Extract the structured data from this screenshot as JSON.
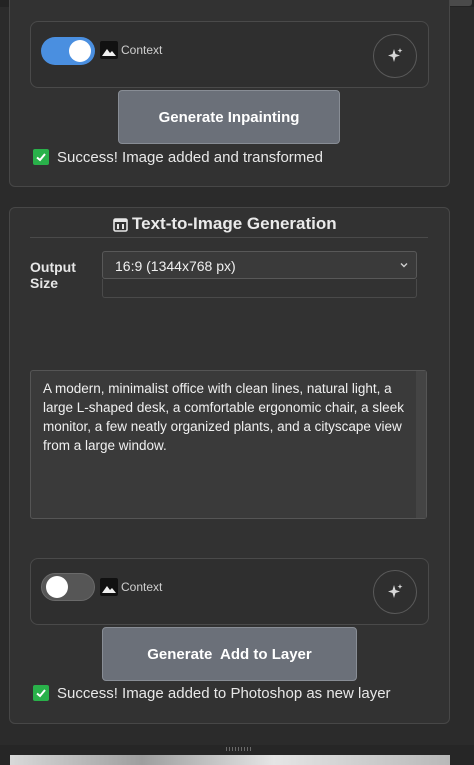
{
  "inpainting_panel": {
    "context_toggle": {
      "label": "Context",
      "on": true
    },
    "generate_button_label": "Generate Inpainting",
    "status_text": "Success! Image added and transformed"
  },
  "text_to_image_panel": {
    "title": "Text-to-Image Generation",
    "output_size": {
      "label_line1": "Output",
      "label_line2": "Size",
      "selected": "16:9 (1344x768 px)"
    },
    "prompt_text": "A modern, minimalist office with clean lines, natural light, a large L-shaped desk, a comfortable ergonomic chair, a sleek monitor, a few neatly organized plants, and a cityscape view from a large window.",
    "context_toggle": {
      "label": "Context",
      "on": false
    },
    "generate_button_label": "Generate  Add to Layer",
    "status_text": "Success! Image added to Photoshop as new layer"
  },
  "colors": {
    "accent_blue": "#4a8fe0",
    "success_green": "#29b14a",
    "button_gray": "#6b7079"
  }
}
